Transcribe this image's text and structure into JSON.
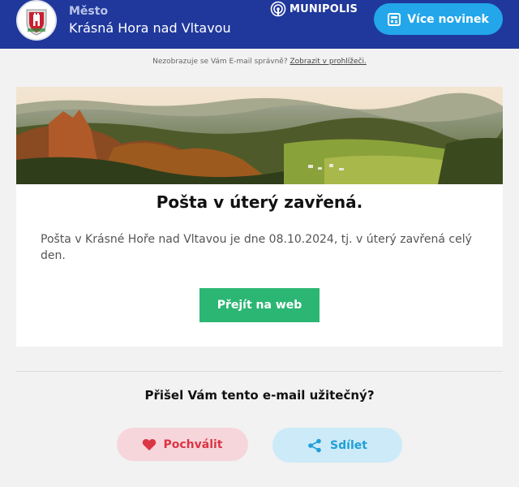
{
  "header": {
    "city_label": "Město",
    "city_name": "Krásná Hora nad Vltavou",
    "platform_name": "MUNIPOLIS",
    "more_news_label": "Více novinek",
    "colors": {
      "bar": "#20389c",
      "button": "#23a6ea"
    }
  },
  "notice": {
    "text": "Nezobrazuje se Vám E-mail správně?",
    "link": "Zobrazit v prohlížeči."
  },
  "article": {
    "title": "Pošta v úterý zavřená.",
    "body": "Pošta v Krásné Hoře nad Vltavou je dne 08.10.2024, tj. v úterý zavřená celý den.",
    "cta_label": "Přejít na web",
    "cta_color": "#2bb673"
  },
  "feedback": {
    "question": "Přišel Vám tento e-mail užitečný?",
    "praise_label": "Pochválit",
    "share_label": "Sdílet",
    "praise_icon": "heart-icon",
    "share_icon": "share-icon"
  }
}
